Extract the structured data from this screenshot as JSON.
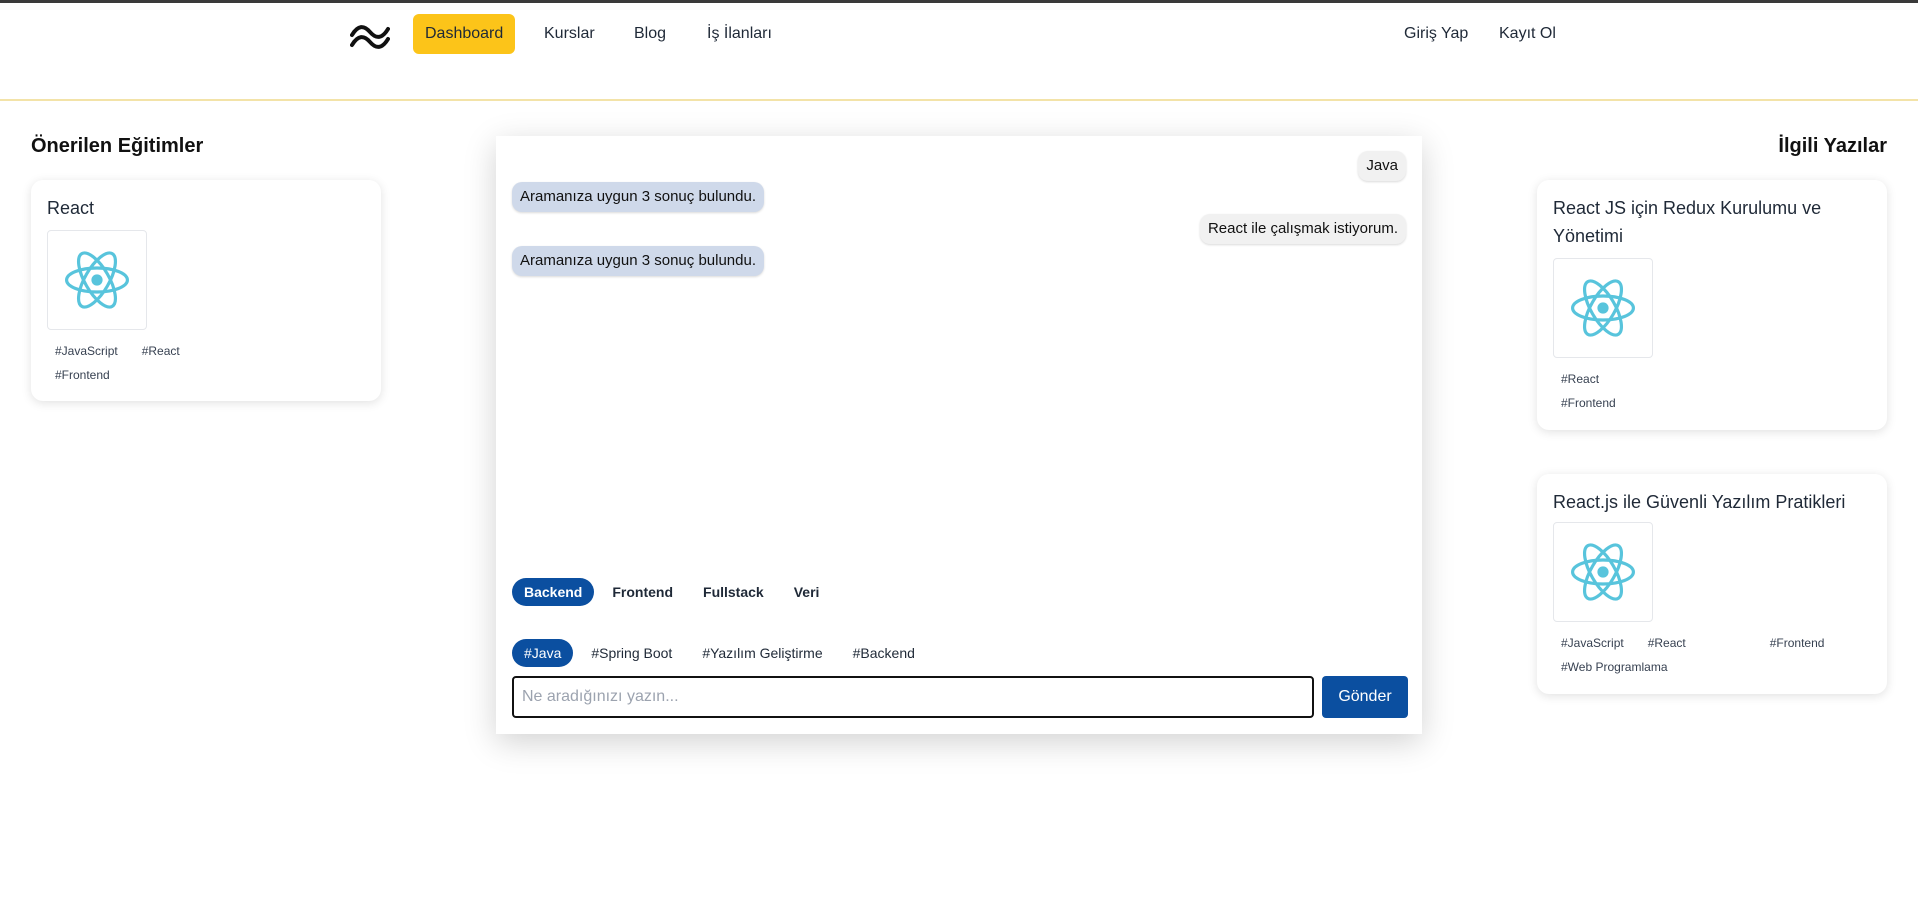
{
  "nav": {
    "logo_icon": "tailwind-wave-icon",
    "items": [
      {
        "label": "Dashboard",
        "active": true
      },
      {
        "label": "Kurslar"
      },
      {
        "label": "Blog"
      },
      {
        "label": "İş İlanları"
      }
    ],
    "login": "Giriş Yap",
    "register": "Kayıt Ol"
  },
  "left": {
    "title": "Önerilen Eğitimler",
    "cards": [
      {
        "title": "React",
        "icon": "react-icon",
        "tags": [
          "#JavaScript",
          "#React",
          "#Frontend"
        ]
      }
    ]
  },
  "right": {
    "title": "İlgili Yazılar",
    "cards": [
      {
        "title": "React JS için Redux Kurulumu ve Yönetimi",
        "icon": "react-icon",
        "tags": [
          "#React",
          "#Frontend"
        ]
      },
      {
        "title": "React.js ile Güvenli Yazılım Pratikleri",
        "icon": "react-icon",
        "tags": [
          "#JavaScript",
          "#React",
          "#Frontend",
          "#Web Programlama"
        ]
      }
    ]
  },
  "chat": {
    "messages": [
      {
        "from": "user",
        "text": "Java"
      },
      {
        "from": "bot",
        "text": "Aramanıza uygun 3 sonuç bulundu."
      },
      {
        "from": "user",
        "text": "React ile çalışmak istiyorum."
      },
      {
        "from": "bot",
        "text": "Aramanıza uygun 3 sonuç bulundu."
      }
    ],
    "categories": [
      {
        "label": "Backend",
        "selected": true
      },
      {
        "label": "Frontend"
      },
      {
        "label": "Fullstack"
      },
      {
        "label": "Veri"
      }
    ],
    "tags": [
      {
        "label": "#Java",
        "selected": true
      },
      {
        "label": "#Spring Boot"
      },
      {
        "label": "#Yazılım Geliştirme"
      },
      {
        "label": "#Backend"
      }
    ],
    "input_placeholder": "Ne aradığınızı yazın...",
    "input_value": "",
    "send_label": "Gönder"
  },
  "colors": {
    "accent_yellow": "#fcc419",
    "primary_blue": "#0b4fa0",
    "react_cyan": "#58c4dc"
  }
}
